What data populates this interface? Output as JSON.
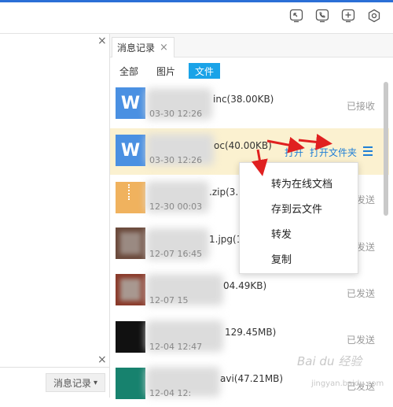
{
  "left": {
    "msg_record_button": "消息记录",
    "dropdown_glyph": "▾"
  },
  "tab": {
    "label": "消息记录"
  },
  "filters": [
    {
      "label": "全部"
    },
    {
      "label": "图片"
    },
    {
      "label": "文件"
    }
  ],
  "files": [
    {
      "name": "inc(38.00KB)",
      "date": "03-30 12:26",
      "status": "已接收",
      "thumb_letter": "W"
    },
    {
      "name": "oc(40.00KB)",
      "date": "03-30 12:26",
      "status": "",
      "thumb_letter": "W",
      "actions": {
        "open": "打开",
        "open_folder": "打开文件夹"
      }
    },
    {
      "name": ".zip(3.",
      "date": "12-30 00:03",
      "status": "发送"
    },
    {
      "name": "1.jpg(1",
      "date": "12-07 16:45",
      "status": "发送"
    },
    {
      "name": "04.49KB)",
      "date": "12-07 15",
      "status": "已发送"
    },
    {
      "name": "129.45MB)",
      "date": "12-04 12:47",
      "status": "已发送"
    },
    {
      "name": "avi(47.21MB)",
      "date": "12-04 12:",
      "status": "已发送"
    }
  ],
  "context_menu": [
    {
      "label": "转为在线文档"
    },
    {
      "label": "存到云文件"
    },
    {
      "label": "转发"
    },
    {
      "label": "复制"
    }
  ],
  "watermark": {
    "main": "Bai du 经验",
    "sub": "jingyan.baidu.com"
  },
  "colors": {
    "accent": "#1aa3e8",
    "highlight_row": "#fbf1d0",
    "link": "#1f7fd6",
    "word_icon": "#4a90e2"
  }
}
